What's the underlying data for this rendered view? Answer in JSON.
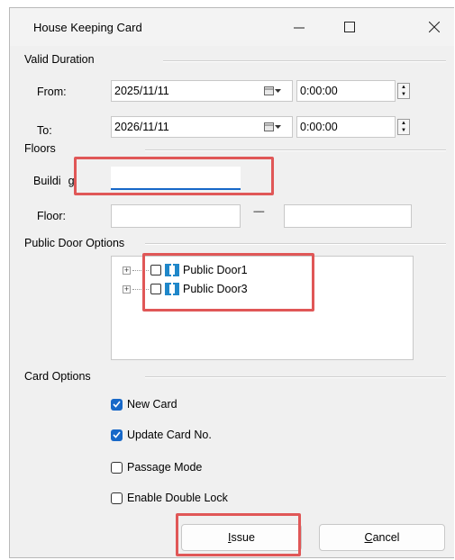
{
  "window": {
    "title": "House Keeping Card"
  },
  "valid_duration": {
    "heading": "Valid Duration",
    "from": {
      "label": "From:",
      "date": "2025/11/11",
      "time": "0:00:00"
    },
    "to": {
      "label": "To:",
      "date": "2026/11/11",
      "time": "0:00:00"
    }
  },
  "floors": {
    "heading": "Floors",
    "building_label": "Buildi",
    "building_label_tail": "g:",
    "building_value": "",
    "floor_label": "Floor:",
    "floor_from": "",
    "floor_sep": "-----",
    "floor_to": ""
  },
  "public_door": {
    "heading": "Public Door Options",
    "items": [
      {
        "label": "Public Door1",
        "checked": false
      },
      {
        "label": "Public Door3",
        "checked": false
      }
    ]
  },
  "card_options": {
    "heading": "Card Options",
    "options": [
      {
        "label": "New Card",
        "checked": true
      },
      {
        "label": "Update Card No.",
        "checked": true
      },
      {
        "label": "Passage Mode",
        "checked": false
      },
      {
        "label": "Enable Double Lock",
        "checked": false
      }
    ]
  },
  "buttons": {
    "issue_hotkey": "I",
    "issue_rest": "ssue",
    "cancel_hotkey": "C",
    "cancel_rest": "ancel"
  },
  "colors": {
    "accent": "#1768c8",
    "highlight": "#e05757",
    "door_icon": "#1f87c9"
  }
}
